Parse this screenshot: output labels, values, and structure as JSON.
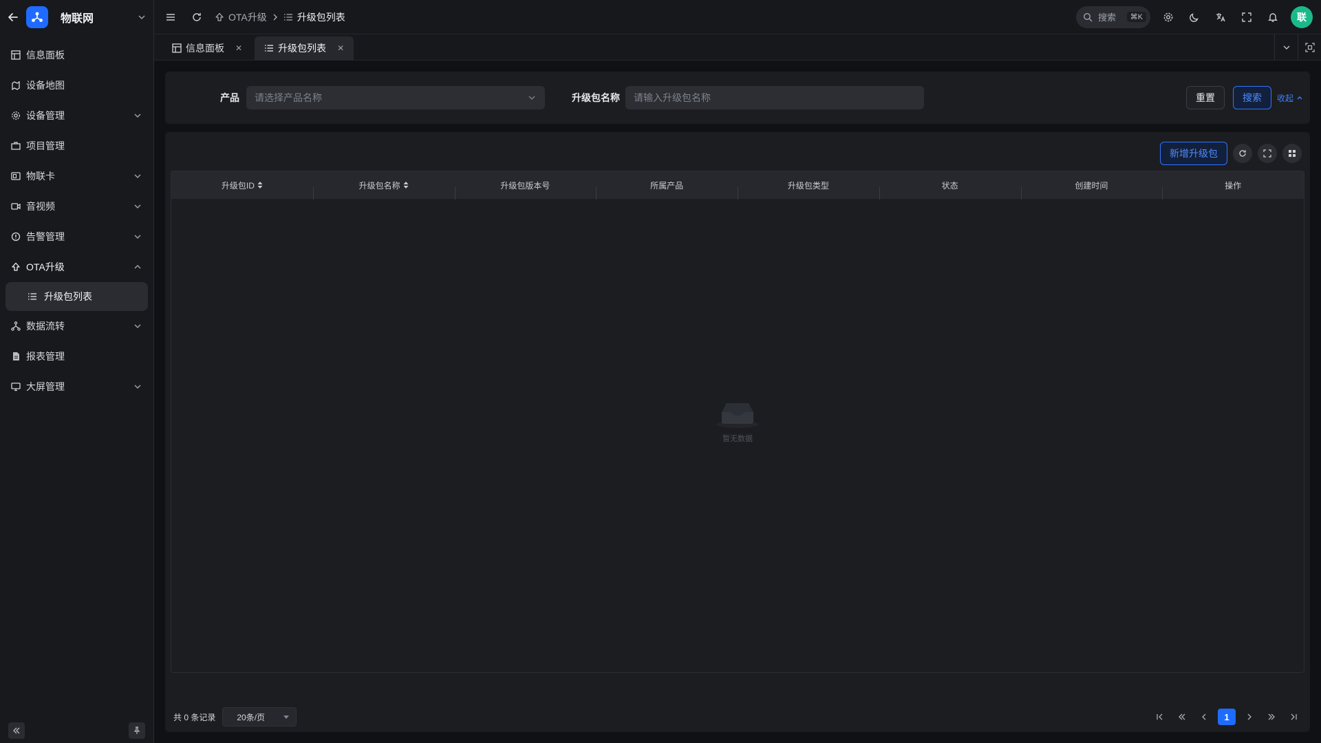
{
  "app": {
    "title": "物联网",
    "avatar_text": "联"
  },
  "sidebar": {
    "items": [
      {
        "label": "信息面板",
        "icon": "dashboard-icon",
        "has_children": false
      },
      {
        "label": "设备地图",
        "icon": "map-icon",
        "has_children": false
      },
      {
        "label": "设备管理",
        "icon": "device-gear-icon",
        "has_children": true
      },
      {
        "label": "项目管理",
        "icon": "briefcase-icon",
        "has_children": false
      },
      {
        "label": "物联卡",
        "icon": "sim-card-icon",
        "has_children": true
      },
      {
        "label": "音视频",
        "icon": "video-icon",
        "has_children": true
      },
      {
        "label": "告警管理",
        "icon": "alert-icon",
        "has_children": true
      },
      {
        "label": "OTA升级",
        "icon": "upgrade-icon",
        "has_children": true,
        "open": true
      },
      {
        "label": "数据流转",
        "icon": "flow-icon",
        "has_children": true
      },
      {
        "label": "报表管理",
        "icon": "report-icon",
        "has_children": false
      },
      {
        "label": "大屏管理",
        "icon": "monitor-icon",
        "has_children": true
      }
    ],
    "sub_active": "升级包列表"
  },
  "topbar": {
    "breadcrumb": [
      "OTA升级",
      "升级包列表"
    ],
    "search_label": "搜索",
    "search_kbd": "⌘K"
  },
  "tabs": [
    {
      "label": "信息面板",
      "active": false
    },
    {
      "label": "升级包列表",
      "active": true
    }
  ],
  "filter": {
    "product_label": "产品",
    "product_placeholder": "请选择产品名称",
    "package_label": "升级包名称",
    "package_placeholder": "请输入升级包名称",
    "reset_label": "重置",
    "search_label": "搜索",
    "collapse_label": "收起"
  },
  "table": {
    "add_button": "新增升级包",
    "columns": [
      "升级包ID",
      "升级包名称",
      "升级包版本号",
      "所属产品",
      "升级包类型",
      "状态",
      "创建时间",
      "操作"
    ],
    "empty_text": "暂无数据"
  },
  "pager": {
    "total_text": "共 0 条记录",
    "page_size": "20条/页",
    "current_page": "1"
  },
  "colors": {
    "accent": "#1e6bff",
    "avatar": "#1bb98a"
  }
}
